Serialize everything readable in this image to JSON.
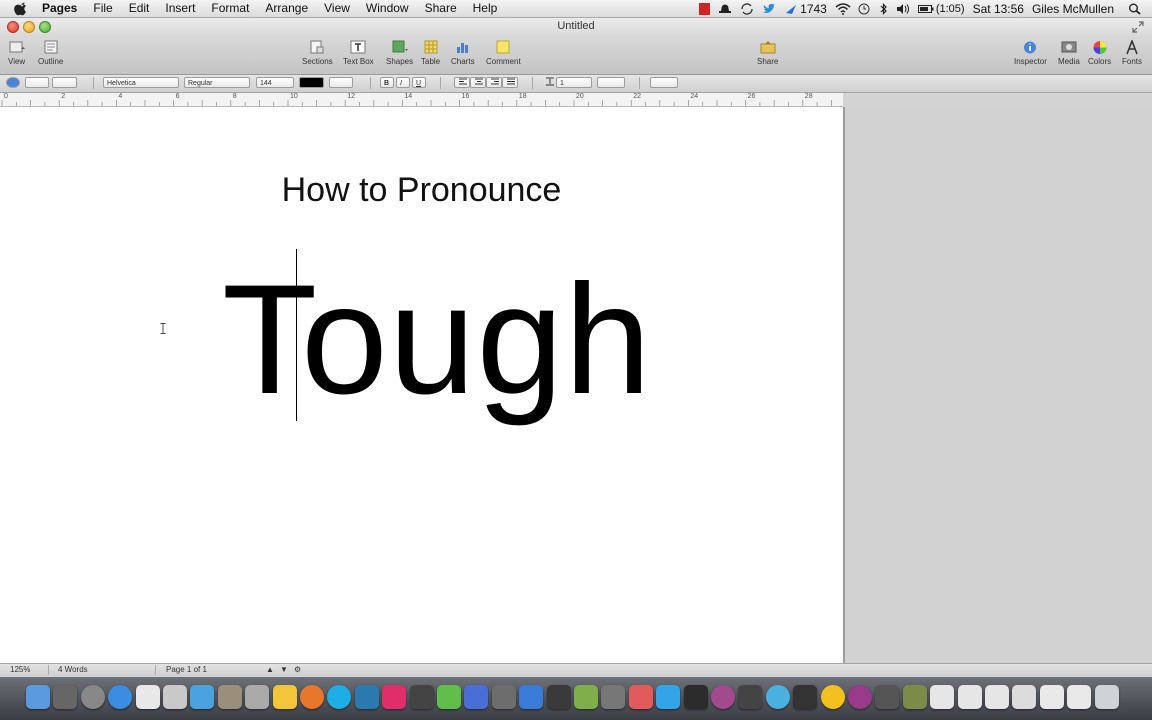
{
  "menubar": {
    "app_name": "Pages",
    "items": [
      "File",
      "Edit",
      "Insert",
      "Format",
      "Arrange",
      "View",
      "Window",
      "Share",
      "Help"
    ],
    "status": {
      "twitter_count": "1743",
      "battery": "(1:05)",
      "clock": "Sat 13:56",
      "user": "Giles McMullen"
    }
  },
  "window": {
    "title": "Untitled"
  },
  "toolbar": {
    "view": "View",
    "outline": "Outline",
    "sections": "Sections",
    "text_box": "Text Box",
    "shapes": "Shapes",
    "table": "Table",
    "charts": "Charts",
    "comment": "Comment",
    "share": "Share",
    "inspector": "Inspector",
    "media": "Media",
    "colors": "Colors",
    "fonts": "Fonts"
  },
  "format_bar": {
    "font_family": "Helvetica",
    "font_style": "Regular",
    "font_size": "144",
    "bold": "B",
    "italic": "I",
    "underline": "U",
    "line_spacing": "1"
  },
  "ruler": {
    "labels": [
      "0",
      "2",
      "4",
      "6",
      "8",
      "10",
      "12",
      "14",
      "16",
      "18",
      "20",
      "22",
      "24",
      "26",
      "28"
    ]
  },
  "document": {
    "heading": "How to Pronounce",
    "word": "Tough"
  },
  "statusbar": {
    "zoom": "125%",
    "word_count": "4 Words",
    "page": "Page 1 of 1"
  },
  "colors": {
    "accent": "#2a6fd6",
    "close": "#d0392b",
    "minimize": "#e0a524",
    "zoom": "#4fa83a"
  }
}
